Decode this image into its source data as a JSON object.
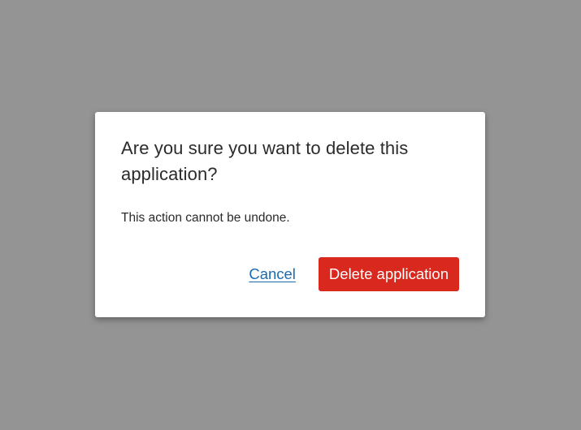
{
  "dialog": {
    "title": "Are you sure you want to delete this application?",
    "message": "This action cannot be undone.",
    "cancel_label": "Cancel",
    "confirm_label": "Delete application"
  },
  "colors": {
    "backdrop": "#949494",
    "dialog_background": "#ffffff",
    "text": "#2b2b2b",
    "link": "#1a6bb3",
    "danger": "#d9281e"
  }
}
